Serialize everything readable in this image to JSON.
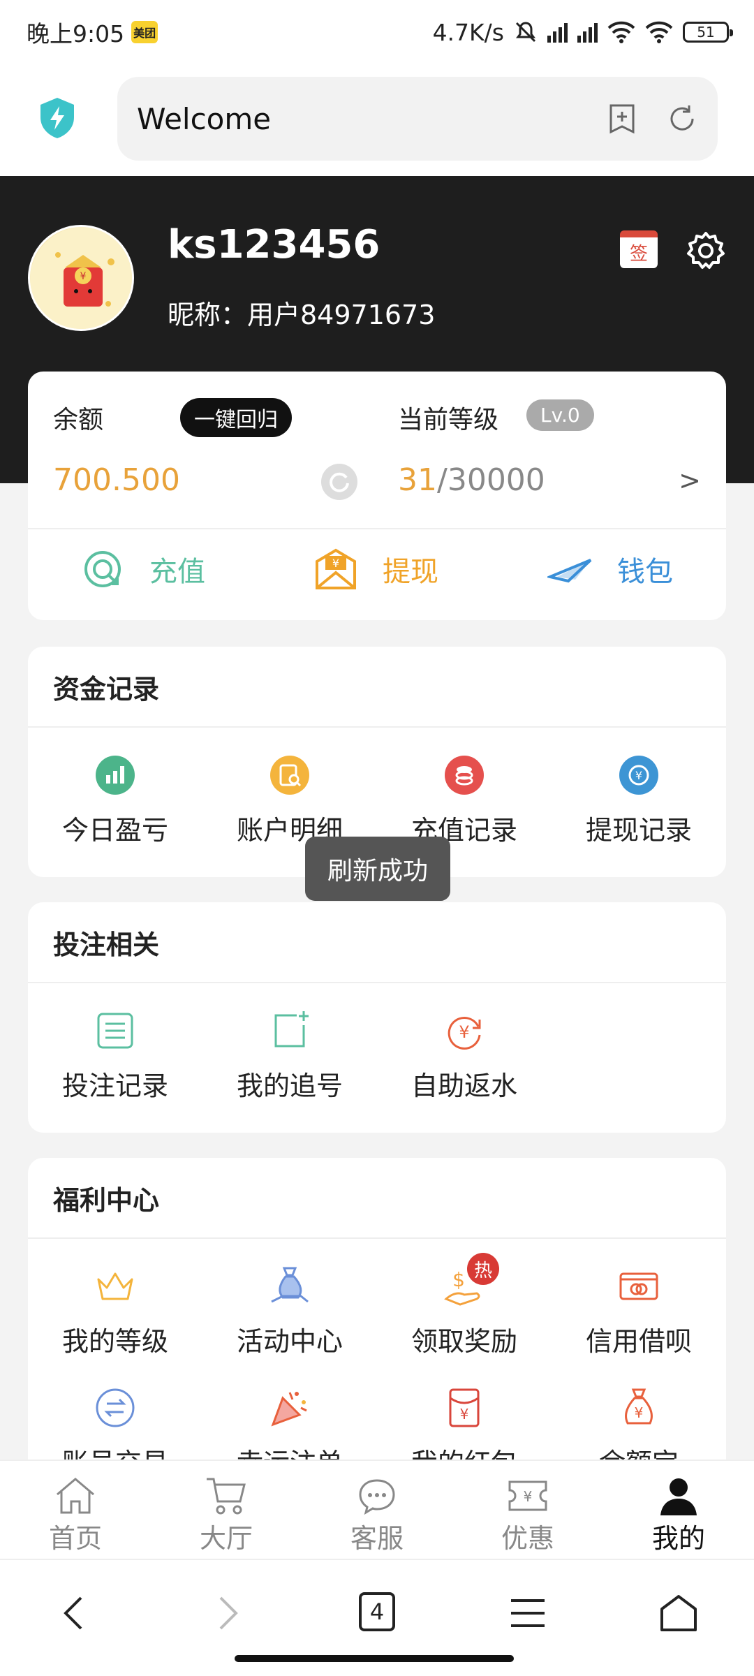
{
  "status_bar": {
    "time": "晚上9:05",
    "badge": "美团",
    "speed": "4.7K/s",
    "battery": "51"
  },
  "browser": {
    "title": "Welcome"
  },
  "profile": {
    "username": "ks123456",
    "nickname": "昵称：用户84971673",
    "sign_label": "签"
  },
  "balance_card": {
    "balance_label": "余额",
    "one_click_label": "一键回归",
    "balance_value": "700.500",
    "level_label": "当前等级",
    "level_badge": "Lv.0",
    "level_current": "31",
    "level_total": "/30000",
    "arrow": ">",
    "actions": [
      {
        "label": "充值",
        "color": "#5bbfa0"
      },
      {
        "label": "提现",
        "color": "#f0a328"
      },
      {
        "label": "钱包",
        "color": "#3a8fd8"
      }
    ]
  },
  "funds_section": {
    "title": "资金记录",
    "items": [
      {
        "label": "今日盈亏",
        "icon": "bar-chart-icon",
        "color": "#4cb48a"
      },
      {
        "label": "账户明细",
        "icon": "search-document-icon",
        "color": "#f4b43c"
      },
      {
        "label": "充值记录",
        "icon": "coins-icon",
        "color": "#e5504d"
      },
      {
        "label": "提现记录",
        "icon": "yuan-exchange-icon",
        "color": "#3d95d4"
      }
    ]
  },
  "betting_section": {
    "title": "投注相关",
    "items": [
      {
        "label": "投注记录",
        "icon": "list-icon",
        "color": "#5bbfa0"
      },
      {
        "label": "我的追号",
        "icon": "add-square-icon",
        "color": "#5bbfa0"
      },
      {
        "label": "自助返水",
        "icon": "yuan-refresh-icon",
        "color": "#e8603c"
      }
    ]
  },
  "welfare_section": {
    "title": "福利中心",
    "items": [
      {
        "label": "我的等级",
        "icon": "crown-icon",
        "color": "#f4b43c"
      },
      {
        "label": "活动中心",
        "icon": "gift-hand-icon",
        "color": "#6a8fd8"
      },
      {
        "label": "领取奖励",
        "icon": "reward-hand-icon",
        "color": "#f4a13c",
        "badge": "热"
      },
      {
        "label": "信用借呗",
        "icon": "credit-card-icon",
        "color": "#e8603c"
      },
      {
        "label": "账号交易",
        "icon": "exchange-icon",
        "color": "#6a8fd8"
      },
      {
        "label": "幸运注单",
        "icon": "party-popper-icon",
        "color": "#e8603c"
      },
      {
        "label": "我的红包",
        "icon": "red-envelope-icon",
        "color": "#d9463b"
      },
      {
        "label": "余额宝",
        "icon": "money-bag-icon",
        "color": "#e8603c"
      }
    ]
  },
  "toast": "刷新成功",
  "bottom_nav": [
    {
      "label": "首页",
      "icon": "home-icon"
    },
    {
      "label": "大厅",
      "icon": "cart-icon"
    },
    {
      "label": "客服",
      "icon": "chat-icon"
    },
    {
      "label": "优惠",
      "icon": "coupon-icon"
    },
    {
      "label": "我的",
      "icon": "user-icon",
      "active": true
    }
  ],
  "browser_nav": {
    "tab_count": "4"
  }
}
